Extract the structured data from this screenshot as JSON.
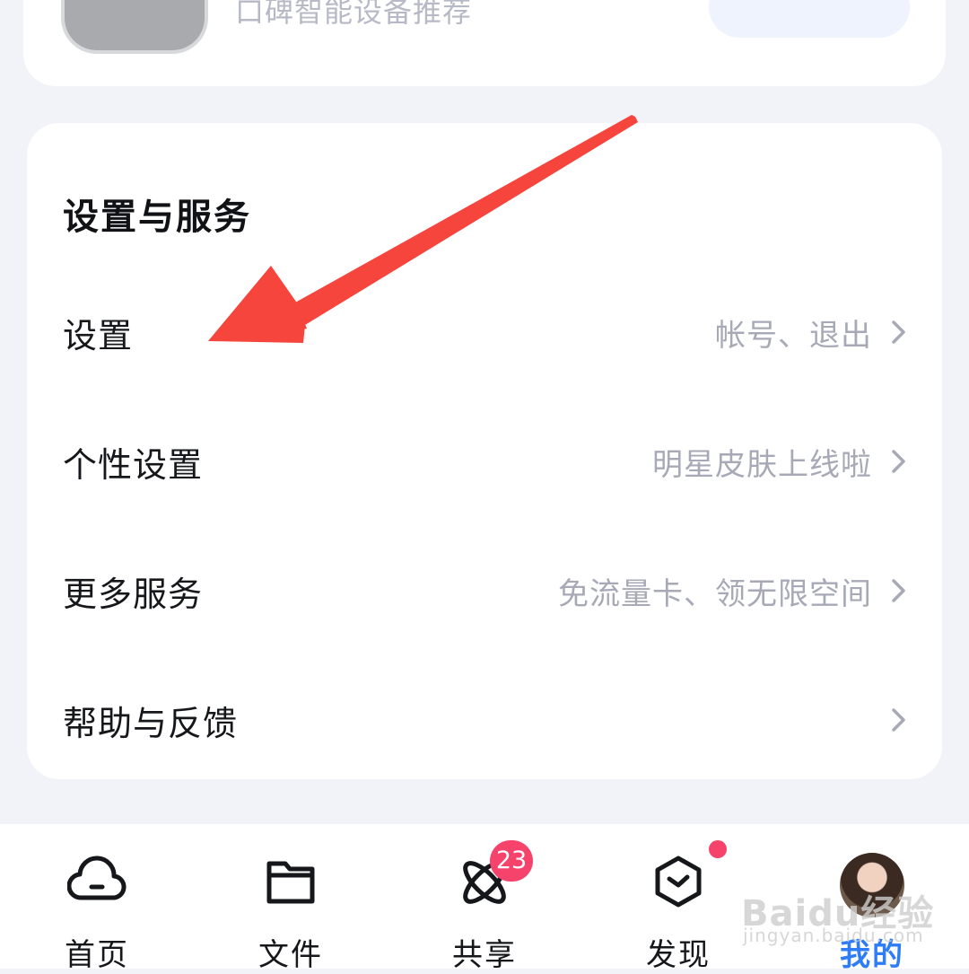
{
  "top_card": {
    "text": "口碑智能设备推荐"
  },
  "settings_section": {
    "title": "设置与服务",
    "rows": [
      {
        "label": "设置",
        "hint": "帐号、退出"
      },
      {
        "label": "个性设置",
        "hint": "明星皮肤上线啦"
      },
      {
        "label": "更多服务",
        "hint": "免流量卡、领无限空间"
      },
      {
        "label": "帮助与反馈",
        "hint": ""
      }
    ]
  },
  "tabbar": {
    "tabs": [
      {
        "label": "首页",
        "icon": "cloud-icon"
      },
      {
        "label": "文件",
        "icon": "folder-icon"
      },
      {
        "label": "共享",
        "icon": "atom-icon",
        "badge": "23"
      },
      {
        "label": "发现",
        "icon": "discover-clock-icon"
      },
      {
        "label": "我的",
        "icon": "avatar",
        "active": true
      }
    ]
  },
  "watermark": {
    "main": "Baidu经验",
    "sub": "jingyan.baidu.com"
  },
  "colors": {
    "background": "#f2f3f8",
    "accent": "#2e7cf6",
    "badge": "#f5436c",
    "annotation_arrow": "#f5453d"
  }
}
